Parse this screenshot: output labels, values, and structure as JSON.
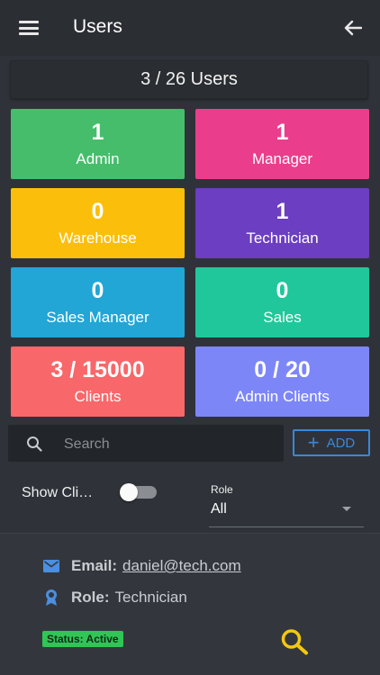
{
  "header": {
    "title": "Users",
    "menu_icon": "hamburger-menu-icon",
    "back_icon": "arrow-left-icon"
  },
  "summary": {
    "text": "3 / 26 Users"
  },
  "role_cards": [
    {
      "count": "1",
      "label": "Admin",
      "color": "#46bd6b"
    },
    {
      "count": "1",
      "label": "Manager",
      "color": "#ea3e8c"
    },
    {
      "count": "0",
      "label": "Warehouse",
      "color": "#fbbf0b"
    },
    {
      "count": "1",
      "label": "Technician",
      "color": "#6c3ec1"
    },
    {
      "count": "0",
      "label": "Sales Manager",
      "color": "#21a6d6"
    },
    {
      "count": "0",
      "label": "Sales",
      "color": "#20c79a"
    },
    {
      "count": "3 / 15000",
      "label": "Clients",
      "color": "#f8676a"
    },
    {
      "count": "0 / 20",
      "label": "Admin Clients",
      "color": "#7d86f7"
    }
  ],
  "search": {
    "placeholder": "Search",
    "value": ""
  },
  "add_button": {
    "label": "ADD"
  },
  "filters": {
    "show_clients_label": "Show Cli…",
    "show_clients_on": false,
    "role_label": "Role",
    "role_value": "All"
  },
  "user": {
    "email_label": "Email:",
    "email": "daniel@tech.com",
    "role_label": "Role:",
    "role": "Technician",
    "status": "Status: Active"
  },
  "colors": {
    "accent": "#3b87d8",
    "icon_blue": "#4a8fe0",
    "status_green": "#2fc656",
    "detail_icon": "#f2c811"
  }
}
